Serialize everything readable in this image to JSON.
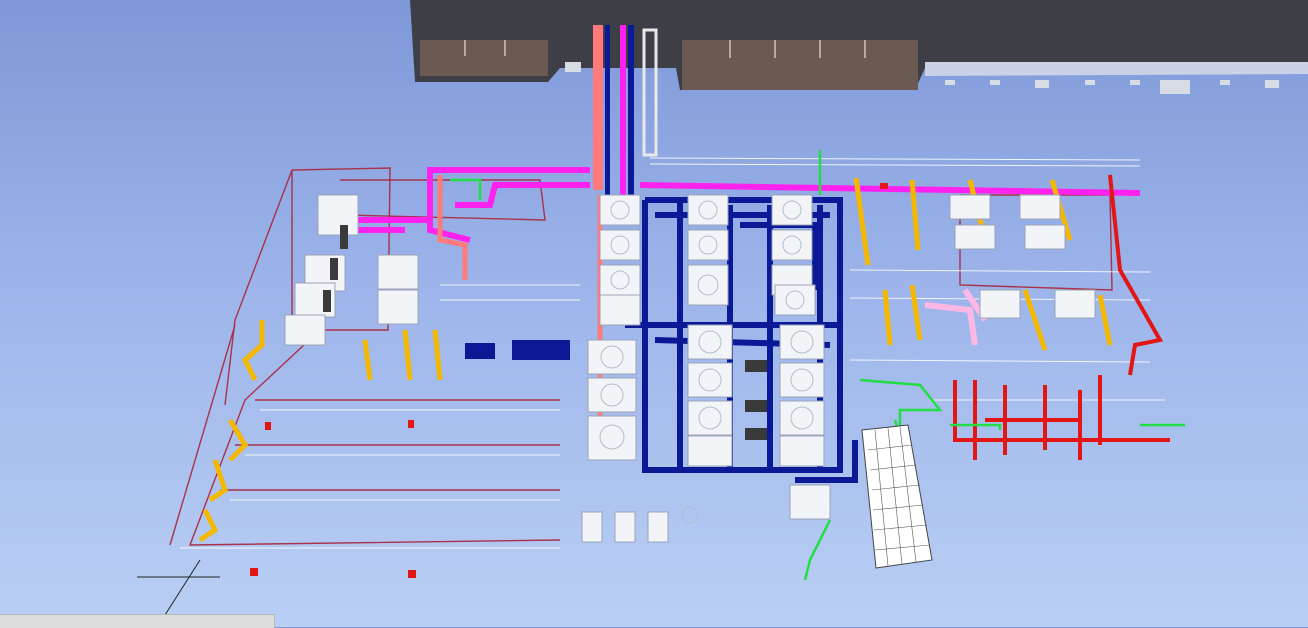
{
  "viewer": {
    "colors": {
      "sky_top": "#7e98d8",
      "sky_bottom": "#b9cff4",
      "building": "#3e3f46",
      "roof_panel": "#6b5a52",
      "supply_duct": "#ff22ee",
      "chilled_water": "#0a1a96",
      "hot_water": "#e31515",
      "condenser_water": "#f5b800",
      "return_pipe": "#ff7a7a",
      "drain_pipe": "#22dd44",
      "frame": "#a8324a",
      "equipment": "#f2f4f8"
    }
  },
  "status_bar": {
    "text": ""
  }
}
